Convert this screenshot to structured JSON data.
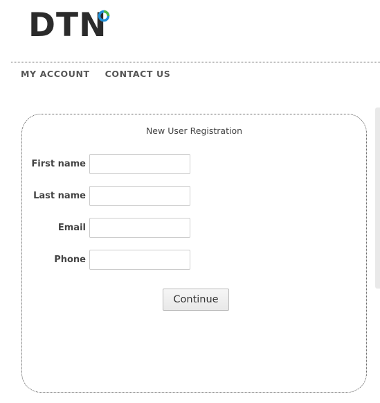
{
  "logo": {
    "text": "DTN",
    "dot_colors": [
      "#4bb848",
      "#1f8fd6"
    ]
  },
  "nav": {
    "items": [
      {
        "label": "MY ACCOUNT"
      },
      {
        "label": "CONTACT US"
      }
    ]
  },
  "form": {
    "title": "New User Registration",
    "fields": [
      {
        "label": "First name",
        "value": "",
        "placeholder": ""
      },
      {
        "label": "Last name",
        "value": "",
        "placeholder": ""
      },
      {
        "label": "Email",
        "value": "",
        "placeholder": ""
      },
      {
        "label": "Phone",
        "value": "",
        "placeholder": ""
      }
    ],
    "continue_label": "Continue"
  }
}
